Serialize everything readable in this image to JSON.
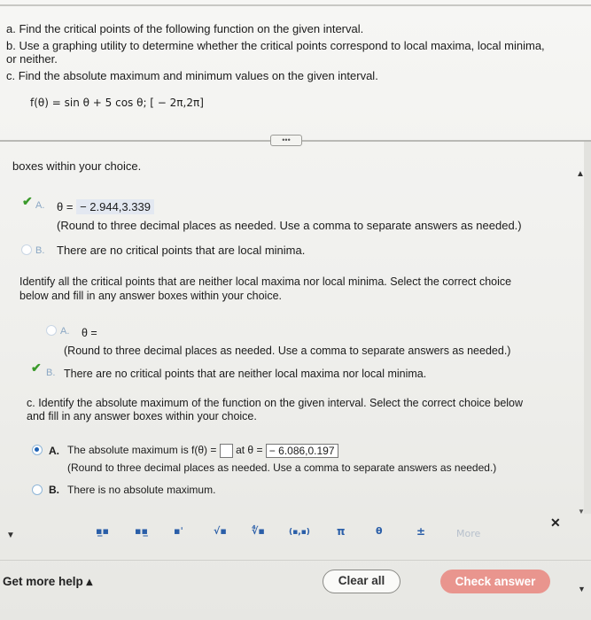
{
  "question": {
    "a": "a. Find the critical points of the following function on the given interval.",
    "b_line1": "b. Use a graphing utility to determine whether the critical points correspond to local maxima, local minima,",
    "b_line2": "or neither.",
    "c": "c. Find the absolute maximum and minimum values on the given interval.",
    "function": "f(θ) = sin θ + 5 cos θ; [ − 2π,2π]"
  },
  "divider_label": "•••",
  "part_minima": {
    "cutoff_text": "boxes within your choice.",
    "option_a": {
      "letter": "A.",
      "prefix": "θ =",
      "value": "− 2.944,3.339",
      "note": "(Round to three decimal places as needed. Use a comma to separate answers as needed.)"
    },
    "option_b": {
      "letter": "B.",
      "text": "There are no critical points that are local minima."
    }
  },
  "part_neither": {
    "prompt_line1": "Identify all the critical points that are neither local maxima nor local minima. Select the correct choice",
    "prompt_line2": "below and fill in any answer boxes within your choice.",
    "option_a": {
      "letter": "A.",
      "prefix": "θ =",
      "note": "(Round to three decimal places as needed. Use a comma to separate answers as needed.)"
    },
    "option_b": {
      "letter": "B.",
      "text": "There are no critical points that are neither local maxima nor local minima."
    }
  },
  "part_c": {
    "prompt_line1": "c. Identify the absolute maximum of the function on the given interval. Select the correct choice below",
    "prompt_line2": "and fill in any answer boxes within your choice.",
    "option_a": {
      "letter": "A.",
      "text1": "The absolute maximum is f(θ) =",
      "text2": "at θ =",
      "value": "− 6.086,0.197",
      "note": "(Round to three decimal places as needed. Use a comma to separate answers as needed.)"
    },
    "option_b": {
      "letter": "B.",
      "text": "There is no absolute maximum."
    }
  },
  "toolbar": {
    "fraction": "▪̲▪",
    "mixed": "▪▪̲",
    "superscript": "▪ˈ",
    "sqrt": "√▪",
    "nthroot": "∜▪",
    "interval": "(▪,▪)",
    "pi": "π",
    "theta": "θ",
    "plusminus": "±",
    "more": "More",
    "close": "✕"
  },
  "footer": {
    "help": "Get more help ▴",
    "clear": "Clear all",
    "check": "Check answer"
  }
}
